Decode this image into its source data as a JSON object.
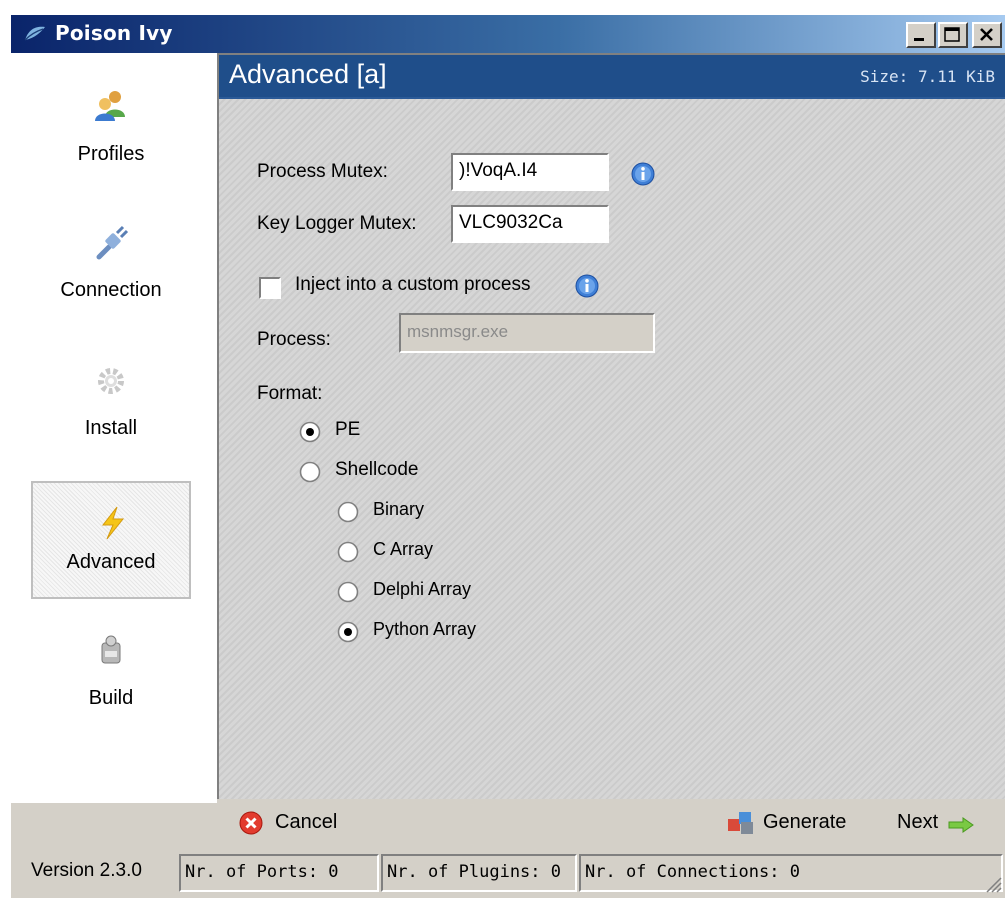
{
  "window": {
    "title": "Poison Ivy",
    "app_icon": "poison-ivy-leaf-icon",
    "controls": [
      "minimize-icon",
      "maximize-icon",
      "close-icon"
    ]
  },
  "sidebar": {
    "items": [
      {
        "label": "Profiles",
        "icon": "users-icon",
        "active": false
      },
      {
        "label": "Connection",
        "icon": "plug-icon",
        "active": false
      },
      {
        "label": "Install",
        "icon": "gear-icon",
        "active": false
      },
      {
        "label": "Advanced",
        "icon": "lightning-icon",
        "active": true
      },
      {
        "label": "Build",
        "icon": "build-icon",
        "active": false
      }
    ]
  },
  "header": {
    "title": "Advanced [a]",
    "size_label": "Size: 7.11 KiB",
    "color": "#1f4e8a"
  },
  "form": {
    "process_mutex": {
      "label": "Process Mutex:",
      "value": ")!VoqA.I4"
    },
    "keylogger_mutex": {
      "label": "Key Logger Mutex:",
      "value": "VLC9032Ca"
    },
    "inject": {
      "label": "Inject into a custom process",
      "checked": false
    },
    "process": {
      "label": "Process:",
      "value": "msnmsgr.exe",
      "disabled": true
    },
    "format": {
      "label": "Format:",
      "options": [
        {
          "label": "PE",
          "selected": true
        },
        {
          "label": "Shellcode",
          "selected": false
        }
      ],
      "shellcode_options": [
        {
          "label": "Binary",
          "selected": false
        },
        {
          "label": "C Array",
          "selected": false
        },
        {
          "label": "Delphi Array",
          "selected": false
        },
        {
          "label": "Python Array",
          "selected": true
        }
      ]
    }
  },
  "actions": {
    "cancel": "Cancel",
    "generate": "Generate",
    "next": "Next"
  },
  "status": {
    "version": "Version 2.3.0",
    "ports": "Nr. of Ports: 0",
    "plugins": "Nr. of Plugins: 0",
    "connections": "Nr. of Connections: 0"
  }
}
